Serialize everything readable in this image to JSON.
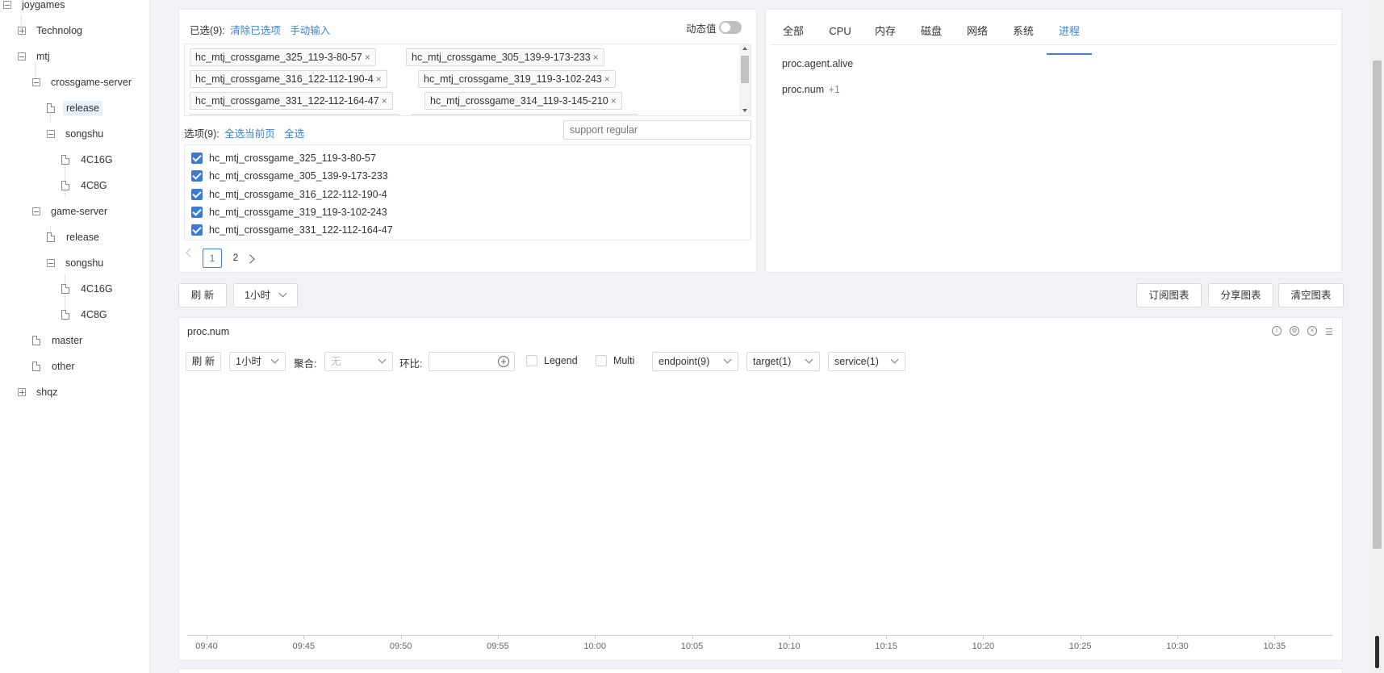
{
  "tree": {
    "root": "joygames",
    "technolog": "Technolog",
    "mtj": "mtj",
    "crossgame_server": "crossgame-server",
    "cs_release": "release",
    "cs_songshu": "songshu",
    "cs_4c16g": "4C16G",
    "cs_4c8g": "4C8G",
    "game_server": "game-server",
    "gs_release": "release",
    "gs_songshu": "songshu",
    "gs_4c16g": "4C16G",
    "gs_4c8g": "4C8G",
    "master": "master",
    "other": "other",
    "shqz": "shqz"
  },
  "selector": {
    "selected_label": "已选(9):",
    "clear_label": "清除已选项",
    "manual_label": "手动输入",
    "dynamic_label": "动态值",
    "dynamic_on": false,
    "tags": [
      "hc_mtj_crossgame_325_119-3-80-57",
      "hc_mtj_crossgame_305_139-9-173-233",
      "hc_mtj_crossgame_316_122-112-190-4",
      "hc_mtj_crossgame_319_119-3-102-243",
      "hc_mtj_crossgame_331_122-112-164-47",
      "hc_mtj_crossgame_314_119-3-145-210"
    ],
    "tag_close": "×",
    "options_label": "选项(9):",
    "select_page_label": "全选当前页",
    "select_all_label": "全选",
    "search_placeholder": "support regular",
    "options": [
      "hc_mtj_crossgame_325_119-3-80-57",
      "hc_mtj_crossgame_305_139-9-173-233",
      "hc_mtj_crossgame_316_122-112-190-4",
      "hc_mtj_crossgame_319_119-3-102-243",
      "hc_mtj_crossgame_331_122-112-164-47"
    ],
    "pages": [
      "1",
      "2"
    ],
    "current_page": "1"
  },
  "metrics": {
    "tabs": [
      "全部",
      "CPU",
      "内存",
      "磁盘",
      "网络",
      "系统",
      "进程"
    ],
    "active_tab": "进程",
    "items": [
      "proc.agent.alive",
      "proc.num"
    ],
    "proc_num_badge": "+1"
  },
  "toolbar": {
    "refresh": "刷 新",
    "range": "1小时",
    "subscribe": "订阅图表",
    "share": "分享图表",
    "clear": "清空图表"
  },
  "chart": {
    "title": "proc.num",
    "refresh": "刷 新",
    "range": "1小时",
    "agg_label": "聚合:",
    "agg_value": "无",
    "ratio_label": "环比:",
    "legend_label": "Legend",
    "multi_label": "Multi",
    "endpoint_label": "endpoint(9)",
    "target_label": "target(1)",
    "service_label": "service(1)",
    "x_ticks": [
      "09:40",
      "09:45",
      "09:50",
      "09:55",
      "10:00",
      "10:05",
      "10:10",
      "10:15",
      "10:20",
      "10:25",
      "10:30",
      "10:35"
    ]
  }
}
